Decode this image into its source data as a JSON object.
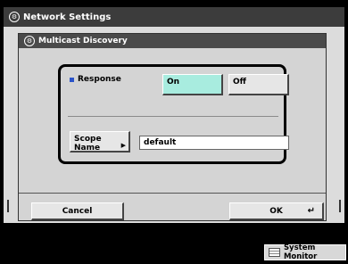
{
  "window": {
    "title": "Network Settings"
  },
  "dialog": {
    "title": "Multicast Discovery"
  },
  "response": {
    "label": "Response",
    "on_label": "On",
    "off_label": "Off",
    "selected": "On"
  },
  "scope": {
    "button_label": "Scope Name",
    "value": "default"
  },
  "footer": {
    "cancel_label": "Cancel",
    "ok_label": "OK"
  },
  "status_bar": {
    "system_monitor_label": "System Monitor"
  },
  "colors": {
    "selected_button": "#a8ecdf",
    "bullet": "#2b54c9",
    "title_bar": "#3c3c3c"
  }
}
